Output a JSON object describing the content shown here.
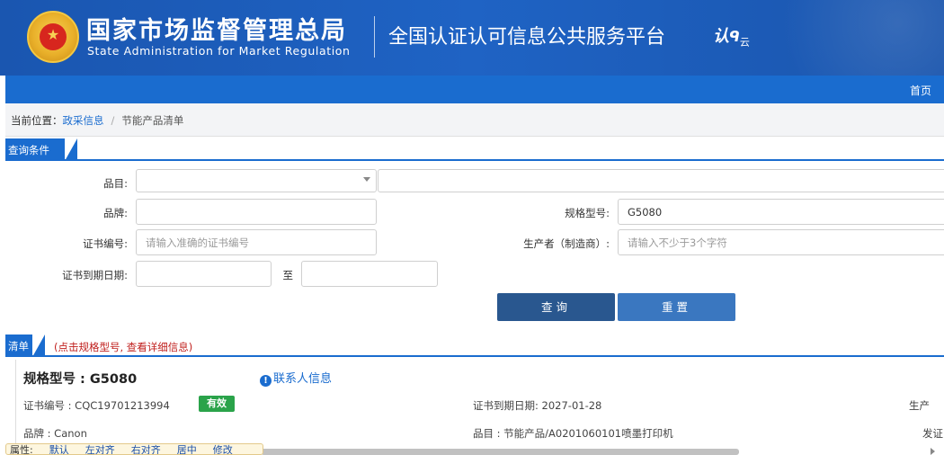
{
  "header": {
    "org_cn": "国家市场监督管理总局",
    "org_en": "State Administration  for  Market Regulation",
    "platform": "全国认证认可信息公共服务平台",
    "platform_logo": "认",
    "platform_logo_sub": "云",
    "emblem_star": "★"
  },
  "nav": {
    "home": "首页"
  },
  "breadcrumb": {
    "prefix": "当前位置：",
    "link": "政采信息",
    "separator": "/",
    "current": "节能产品清单"
  },
  "query": {
    "section_title": "查询条件",
    "category_label": "品目:",
    "brand_label": "品牌:",
    "model_label": "规格型号:",
    "model_value": "G5080",
    "cert_no_label": "证书编号:",
    "cert_no_placeholder": "请输入准确的证书编号",
    "producer_label": "生产者（制造商）:",
    "producer_placeholder": "请输入不少于3个字符",
    "expiry_label": "证书到期日期:",
    "date_to": "至",
    "query_button": "查询",
    "reset_button": "重置"
  },
  "list": {
    "section_title": "清单",
    "section_note": "(点击规格型号, 查看详细信息)",
    "item": {
      "model_title": "规格型号 : G5080",
      "contact_icon": "!",
      "contact_label": "联系人信息",
      "cert_no": "证书编号 : CQC19701213994",
      "status": "有效",
      "expiry": "证书到期日期: 2027-01-28",
      "brand": "品牌 : Canon",
      "category": "品目 : 节能产品/A0201060101喷墨打印机",
      "right_edge_1": "生产",
      "right_edge_2": "发证"
    }
  },
  "toolbar": {
    "label": "属性:",
    "items": [
      "默认",
      "左对齐",
      "右对齐",
      "居中",
      "修改"
    ]
  }
}
